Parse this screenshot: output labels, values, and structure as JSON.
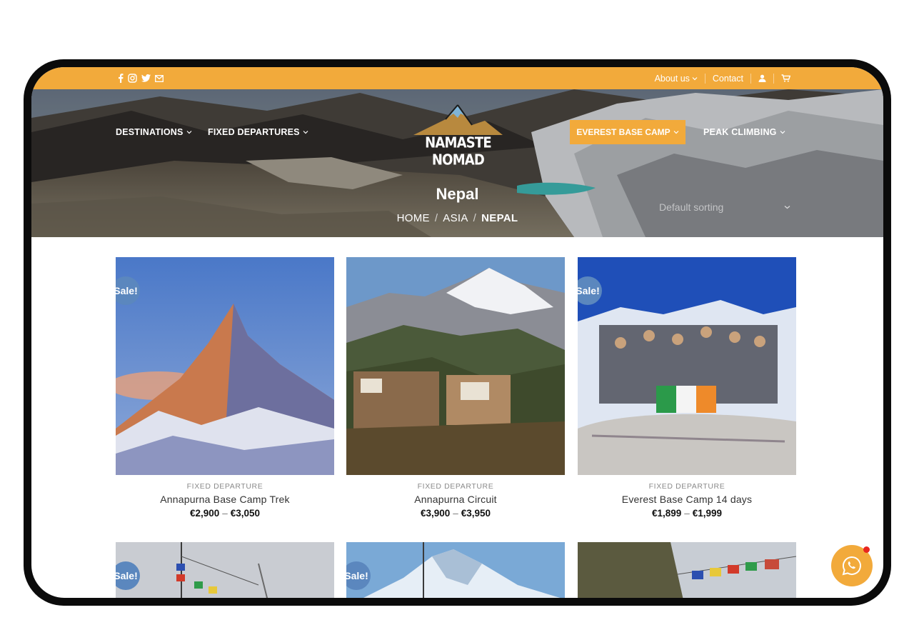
{
  "topbar": {
    "social_icons": [
      "facebook-icon",
      "instagram-icon",
      "twitter-icon",
      "envelope-icon"
    ],
    "links": [
      {
        "label": "About us",
        "has_dropdown": true
      },
      {
        "label": "Contact",
        "has_dropdown": false
      }
    ],
    "icons": [
      "user-icon",
      "cart-icon"
    ]
  },
  "nav": {
    "left": [
      {
        "label": "DESTINATIONS",
        "has_dropdown": true
      },
      {
        "label": "FIXED DEPARTURES",
        "has_dropdown": true
      }
    ],
    "right": [
      {
        "label": "EVEREST BASE CAMP",
        "has_dropdown": true,
        "active": true
      },
      {
        "label": "PEAK CLIMBING",
        "has_dropdown": true
      }
    ]
  },
  "logo": {
    "text": "NAMASTE NOMAD"
  },
  "hero": {
    "title": "Nepal",
    "breadcrumbs": [
      "HOME",
      "ASIA",
      "NEPAL"
    ],
    "sorting": "Default sorting"
  },
  "products": [
    {
      "category": "FIXED DEPARTURE",
      "name": "Annapurna Base Camp Trek",
      "price_min": "€2,900",
      "price_max": "€3,050",
      "sale": "Sale!"
    },
    {
      "category": "FIXED DEPARTURE",
      "name": "Annapurna Circuit",
      "price_min": "€3,900",
      "price_max": "€3,950",
      "sale": ""
    },
    {
      "category": "FIXED DEPARTURE",
      "name": "Everest Base Camp 14 days",
      "price_min": "€1,899",
      "price_max": "€1,999",
      "sale": "Sale!"
    }
  ],
  "products_row2": [
    {
      "sale": "Sale!"
    },
    {
      "sale": "Sale!"
    },
    {
      "sale": ""
    }
  ],
  "price_separator": "–",
  "colors": {
    "accent": "#f2aa3b",
    "sale_badge": "#5b87be",
    "notification": "#e8261f"
  }
}
